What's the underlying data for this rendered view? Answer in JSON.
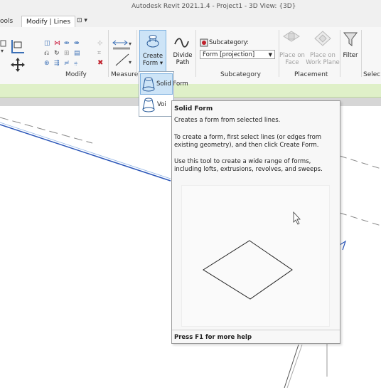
{
  "window": {
    "title": "Autodesk Revit 2021.1.4 - Project1 - 3D View: {3D}"
  },
  "tabs": {
    "tools": "ools",
    "modify_lines": "Modify | Lines",
    "extra": "⊡ ▾"
  },
  "ribbon": {
    "groups": {
      "modify": "Modify",
      "measure": "Measure",
      "subcategory": "Subcategory",
      "placement": "Placement",
      "select": "Selec"
    },
    "create_form": {
      "line1": "Create",
      "line2": "Form ▾"
    },
    "divide_path": {
      "line1": "Divide",
      "line2": "Path"
    },
    "subcategory_label": "Subcategory:",
    "subcategory_value": "Form [projection]",
    "place_on_face": {
      "line1": "Place on",
      "line2": "Face"
    },
    "place_on_work_plane": {
      "line1": "Place on",
      "line2": "Work Plane"
    },
    "filter": "Filter"
  },
  "dropdown": {
    "solid_form": "Solid Form",
    "void_form": "Voi"
  },
  "tooltip": {
    "title": "Solid Form",
    "line1": "Creates a form from selected lines.",
    "line2": "To create a form, first select lines (or edges from existing geometry), and then click Create Form.",
    "line3": "Use this tool to create a wide range of forms, including lofts, extrusions, revolves, and sweeps.",
    "footer": "Press F1 for more help"
  },
  "colors": {
    "ribbon_bg": "#f7f7f7",
    "context_green": "#dff0c8",
    "highlight_blue": "#cde4f7",
    "line_blue": "#1f4fb0"
  }
}
